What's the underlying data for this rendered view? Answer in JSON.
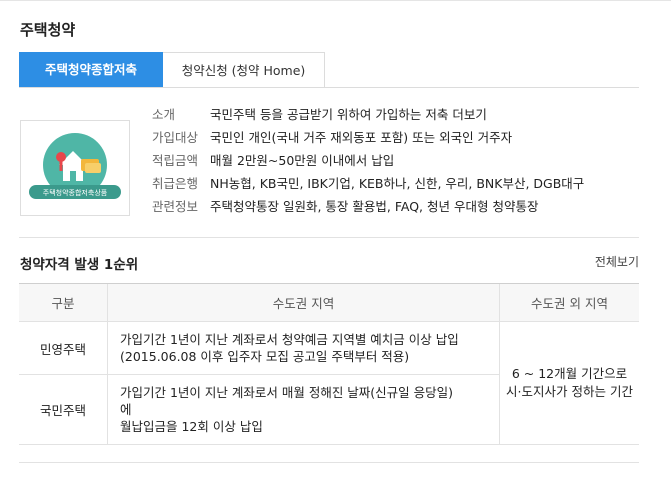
{
  "title": "주택청약",
  "tabs": [
    {
      "label": "주택청약종합저축",
      "active": true
    },
    {
      "label": "청약신청 (청약 Home)",
      "active": false
    }
  ],
  "logo": {
    "caption": "주택청약종합저축상품",
    "icon": "house-savings-icon"
  },
  "info": [
    {
      "label": "소개",
      "value": "국민주택 등을 공급받기 위하여 가입하는 저축 더보기"
    },
    {
      "label": "가입대상",
      "value": "국민인 개인(국내 거주 재외동포 포함) 또는 외국인 거주자"
    },
    {
      "label": "적립금액",
      "value": "매월 2만원~50만원 이내에서 납입"
    },
    {
      "label": "취급은행",
      "value": "NH농협, KB국민, IBK기업, KEB하나, 신한, 우리, BNK부산, DGB대구"
    },
    {
      "label": "관련정보",
      "value": "주택청약통장 일원화, 통장 활용법, FAQ, 청년 우대형 청약통장"
    }
  ],
  "section": {
    "title": "청약자격 발생 1순위",
    "view_all": "전체보기"
  },
  "table": {
    "headers": [
      "구분",
      "수도권 지역",
      "수도권 외 지역"
    ],
    "rows": [
      {
        "type": "민영주택",
        "desc": "가입기간 1년이 지난 계좌로서 청약예금 지역별 예치금 이상 납입 (2015.06.08 이후 입주자 모집 공고일 주택부터 적용)"
      },
      {
        "type": "국민주택",
        "desc_line1": "가입기간 1년이 지난 계좌로서 매월 정해진 날짜(신규일 응당일)",
        "desc_line2": "에",
        "desc_line3": "월납입금을 12회 이상 납입"
      }
    ],
    "outside_line1": "6 ~ 12개월 기간으로",
    "outside_line2": "시·도지사가 정하는 기간"
  }
}
